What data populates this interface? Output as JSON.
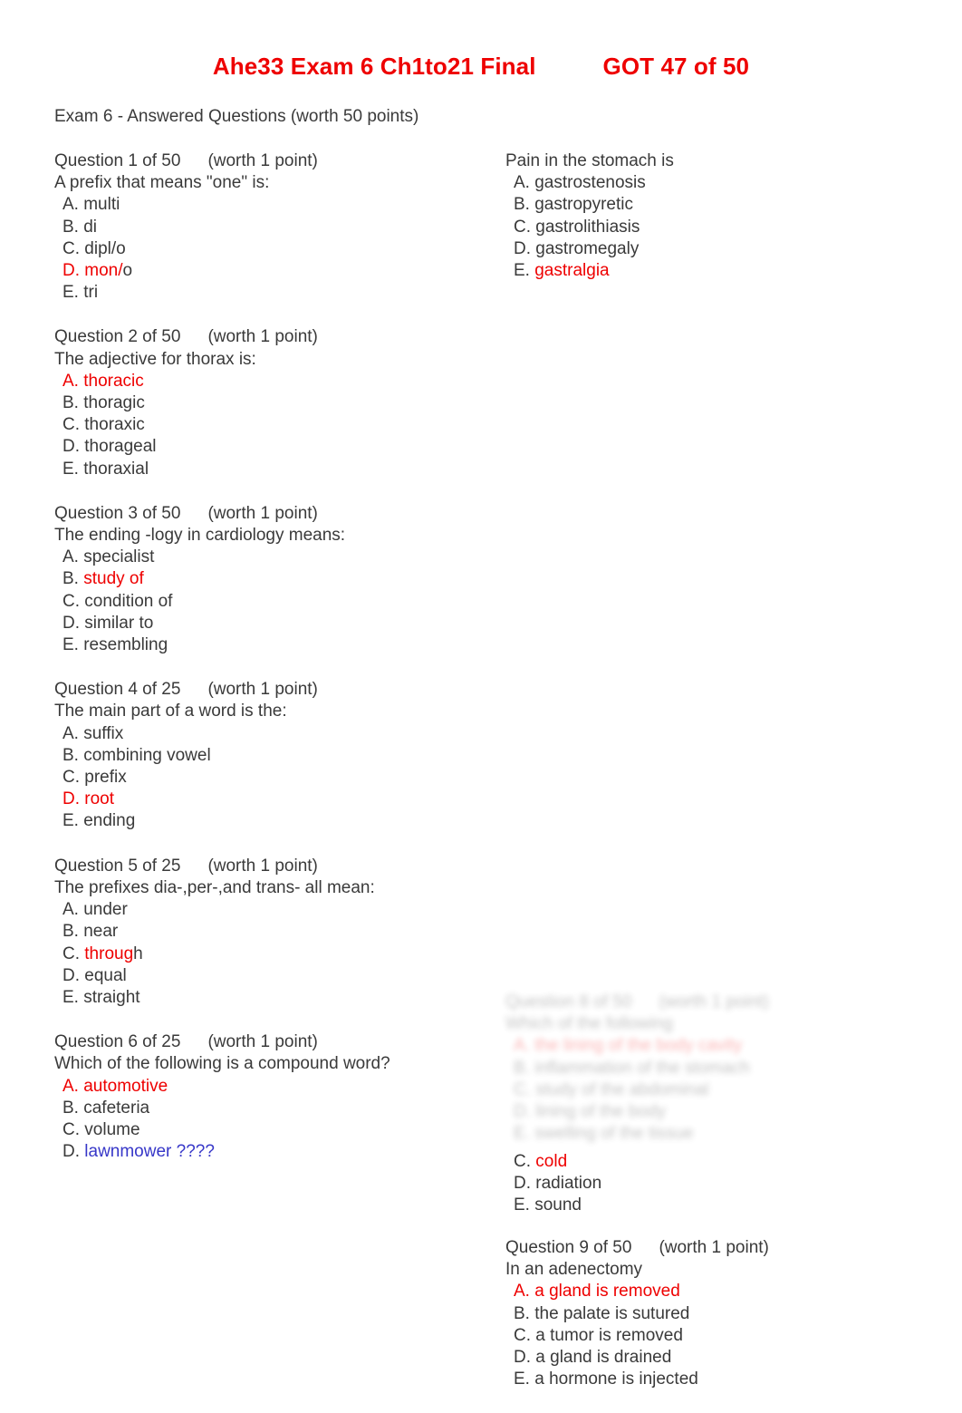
{
  "document": {
    "title_main": "Ahe33 Exam 6 Ch1to21 Final",
    "title_score": "GOT 47 of 50",
    "subtitle": "Exam 6 - Answered Questions (worth 50 points)",
    "title_color": "#ee0000",
    "answer_color": "#ee0000",
    "note_color": "#3737c8",
    "body_color": "#3a3a3a"
  },
  "left_column": [
    {
      "head": "Question 1 of 50",
      "worth": "(worth 1 point)",
      "text": "A prefix that means \"one\" is:",
      "options": [
        {
          "letter": "A.",
          "letter_color": "black",
          "text": " multi",
          "text_color": "black"
        },
        {
          "letter": "B.",
          "letter_color": "black",
          "text": " di",
          "text_color": "black"
        },
        {
          "letter": "C.",
          "letter_color": "black",
          "text": " dipl/o",
          "text_color": "black"
        },
        {
          "letter": "D.",
          "letter_color": "red",
          "text": " mon/",
          "text_color": "red",
          "suffix": "o",
          "suffix_color": "black"
        },
        {
          "letter": "E.",
          "letter_color": "black",
          "text": " tri",
          "text_color": "black"
        }
      ]
    },
    {
      "head": "Question 2 of 50",
      "worth": "(worth 1 point)",
      "text": "The adjective for thorax is:",
      "options": [
        {
          "letter": "A.",
          "letter_color": "red",
          "text": " thoracic",
          "text_color": "red"
        },
        {
          "letter": "B.",
          "letter_color": "black",
          "text": " thoragic",
          "text_color": "black"
        },
        {
          "letter": "C.",
          "letter_color": "black",
          "text": " thoraxic",
          "text_color": "black"
        },
        {
          "letter": "D.",
          "letter_color": "black",
          "text": " thorageal",
          "text_color": "black"
        },
        {
          "letter": "E.",
          "letter_color": "black",
          "text": " thoraxial",
          "text_color": "black"
        }
      ]
    },
    {
      "head": "Question 3 of 50",
      "worth": "(worth 1 point)",
      "text": "The ending -logy in cardiology means:",
      "options": [
        {
          "letter": "A.",
          "letter_color": "black",
          "text": " specialist",
          "text_color": "black"
        },
        {
          "letter": "B.",
          "letter_color": "black",
          "text": " study of",
          "text_color": "red"
        },
        {
          "letter": "C.",
          "letter_color": "black",
          "text": " condition of",
          "text_color": "black"
        },
        {
          "letter": "D.",
          "letter_color": "black",
          "text": " similar to",
          "text_color": "black"
        },
        {
          "letter": "E.",
          "letter_color": "black",
          "text": " resembling",
          "text_color": "black"
        }
      ]
    },
    {
      "head": "Question 4 of 25",
      "worth": "(worth 1 point)",
      "text": "The main part of a word is the:",
      "options": [
        {
          "letter": "A.",
          "letter_color": "black",
          "text": " suffix",
          "text_color": "black"
        },
        {
          "letter": "B.",
          "letter_color": "black",
          "text": " combining vowel",
          "text_color": "black"
        },
        {
          "letter": "C.",
          "letter_color": "black",
          "text": " prefix",
          "text_color": "black"
        },
        {
          "letter": "D.",
          "letter_color": "red",
          "text": " root",
          "text_color": "red"
        },
        {
          "letter": "E.",
          "letter_color": "black",
          "text": " ending",
          "text_color": "black"
        }
      ]
    },
    {
      "head": "Question 5 of 25",
      "worth": "(worth 1 point)",
      "text": "The prefixes dia-,per-,and trans- all mean:",
      "options": [
        {
          "letter": "A.",
          "letter_color": "black",
          "text": " under",
          "text_color": "black"
        },
        {
          "letter": "B.",
          "letter_color": "black",
          "text": " near",
          "text_color": "black"
        },
        {
          "letter": "C.",
          "letter_color": "black",
          "text": " throug",
          "text_color": "red",
          "suffix": "h",
          "suffix_color": "black"
        },
        {
          "letter": "D.",
          "letter_color": "black",
          "text": " equal",
          "text_color": "black"
        },
        {
          "letter": "E.",
          "letter_color": "black",
          "text": " straight",
          "text_color": "black"
        }
      ]
    },
    {
      "head": "Question 6 of 25",
      "worth": "(worth 1 point)",
      "text": "Which of the following is a compound word?",
      "options": [
        {
          "letter": "A.",
          "letter_color": "red",
          "text": " automotive",
          "text_color": "red"
        },
        {
          "letter": "B.",
          "letter_color": "black",
          "text": " cafeteria",
          "text_color": "black"
        },
        {
          "letter": "C.",
          "letter_color": "black",
          "text": " volume",
          "text_color": "black"
        },
        {
          "letter": "D.",
          "letter_color": "black",
          "text": " lawnmower ????",
          "text_color": "blue"
        }
      ]
    }
  ],
  "right_column": {
    "first_block": {
      "text": "Pain in the stomach is",
      "options": [
        {
          "letter": "A.",
          "letter_color": "black",
          "text": " gastrostenosis",
          "text_color": "black"
        },
        {
          "letter": "B.",
          "letter_color": "black",
          "text": " gastropyretic",
          "text_color": "black"
        },
        {
          "letter": "C.",
          "letter_color": "black",
          "text": " gastrolithiasis",
          "text_color": "black"
        },
        {
          "letter": "D.",
          "letter_color": "black",
          "text": " gastromegaly",
          "text_color": "black"
        },
        {
          "letter": "E.",
          "letter_color": "black",
          "text": " gastralgia",
          "text_color": "red"
        }
      ]
    },
    "faded_block": {
      "head": "Question 8 of 50",
      "worth": "(worth 1 point)",
      "text": "Which of the following",
      "options": [
        {
          "letter": "A.",
          "letter_color": "red",
          "text": " the lining of the body cavity",
          "text_color": "red"
        },
        {
          "letter": "B.",
          "letter_color": "black",
          "text": " inflammation of the stomach",
          "text_color": "black"
        },
        {
          "letter": "C.",
          "letter_color": "black",
          "text": " study of the abdominal",
          "text_color": "black"
        },
        {
          "letter": "D.",
          "letter_color": "black",
          "text": " lining of the body",
          "text_color": "black"
        },
        {
          "letter": "E.",
          "letter_color": "black",
          "text": " swelling of the tissue",
          "text_color": "black"
        }
      ]
    },
    "tail_options": [
      {
        "letter": "C.",
        "letter_color": "black",
        "text": " cold",
        "text_color": "red"
      },
      {
        "letter": "D.",
        "letter_color": "black",
        "text": " radiation",
        "text_color": "black"
      },
      {
        "letter": "E.",
        "letter_color": "black",
        "text": " sound",
        "text_color": "black"
      }
    ],
    "question9": {
      "head": "Question 9 of 50",
      "worth": "(worth 1 point)",
      "text": "In an adenectomy",
      "options": [
        {
          "letter": "A.",
          "letter_color": "red",
          "text": " a gland is removed",
          "text_color": "red"
        },
        {
          "letter": "B.",
          "letter_color": "black",
          "text": " the palate is sutured",
          "text_color": "black"
        },
        {
          "letter": "C.",
          "letter_color": "black",
          "text": " a tumor is removed",
          "text_color": "black"
        },
        {
          "letter": "D.",
          "letter_color": "black",
          "text": " a gland is drained",
          "text_color": "black"
        },
        {
          "letter": "E.",
          "letter_color": "black",
          "text": " a hormone is injected",
          "text_color": "black"
        }
      ]
    }
  }
}
